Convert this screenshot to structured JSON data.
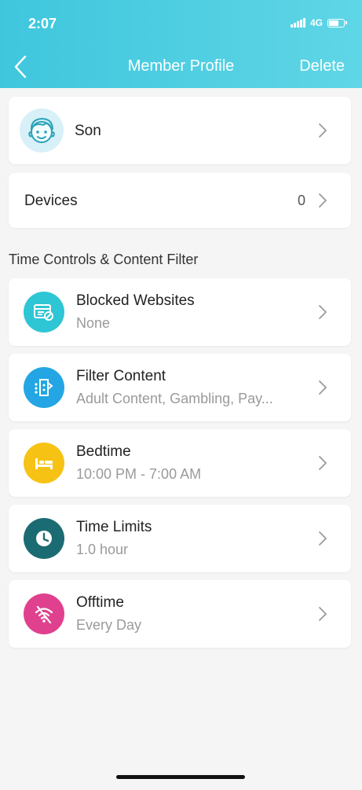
{
  "status_bar": {
    "time": "2:07",
    "network": "4G"
  },
  "header": {
    "title": "Member Profile",
    "delete_label": "Delete"
  },
  "profile": {
    "name": "Son"
  },
  "devices": {
    "label": "Devices",
    "count": "0"
  },
  "section": {
    "title": "Time Controls & Content Filter"
  },
  "items": [
    {
      "title": "Blocked Websites",
      "subtitle": "None",
      "icon": "blocked-websites-icon",
      "color": "#2ec6d4"
    },
    {
      "title": "Filter Content",
      "subtitle": "Adult Content, Gambling, Pay...",
      "icon": "filter-content-icon",
      "color": "#23a6e3"
    },
    {
      "title": "Bedtime",
      "subtitle": "10:00 PM - 7:00 AM",
      "icon": "bed-icon",
      "color": "#f6c315"
    },
    {
      "title": "Time Limits",
      "subtitle": "1.0 hour",
      "icon": "clock-icon",
      "color": "#1b6b73"
    },
    {
      "title": "Offtime",
      "subtitle": "Every Day",
      "icon": "wifi-off-icon",
      "color": "#e0418f"
    }
  ],
  "colors": {
    "header_start": "#3fc6dd",
    "header_end": "#5fd6e6",
    "background": "#f5f5f5"
  }
}
